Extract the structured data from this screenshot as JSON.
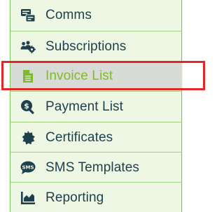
{
  "sidebar": {
    "items": [
      {
        "label": "Comms",
        "icon": "comms-icon",
        "active": false
      },
      {
        "label": "Subscriptions",
        "icon": "users-gear-icon",
        "active": false
      },
      {
        "label": "Invoice List",
        "icon": "document-icon",
        "active": true
      },
      {
        "label": "Payment List",
        "icon": "dollar-search-icon",
        "active": false
      },
      {
        "label": "Certificates",
        "icon": "certificate-icon",
        "active": false
      },
      {
        "label": "SMS Templates",
        "icon": "sms-icon",
        "active": false
      },
      {
        "label": "Reporting",
        "icon": "chart-icon",
        "active": false
      }
    ]
  },
  "colors": {
    "text": "#1e3f4c",
    "active_text": "#7dbb2c",
    "active_bg": "#d9dcd6",
    "panel_bg": "#eef7e4",
    "divider": "#9fd27f",
    "highlight": "#e52626"
  }
}
